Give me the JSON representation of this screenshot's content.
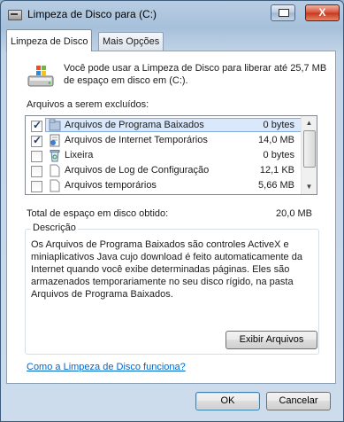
{
  "window": {
    "title": "Limpeza de Disco para  (C:)",
    "close_label": "X"
  },
  "tabs": [
    {
      "label": "Limpeza de Disco",
      "active": true
    },
    {
      "label": "Mais Opções",
      "active": false
    }
  ],
  "intro_text": "Você pode usar a Limpeza de Disco para liberar até 25,7 MB de espaço em disco em  (C:).",
  "files_label": "Arquivos a serem excluídos:",
  "files": [
    {
      "name": "Arquivos de Programa Baixados",
      "size": "0 bytes",
      "checked": true,
      "selected": true,
      "icon": "folder-icon"
    },
    {
      "name": "Arquivos de Internet Temporários",
      "size": "14,0 MB",
      "checked": true,
      "selected": false,
      "icon": "internet-files-icon"
    },
    {
      "name": "Lixeira",
      "size": "0 bytes",
      "checked": false,
      "selected": false,
      "icon": "recycle-bin-icon"
    },
    {
      "name": "Arquivos de Log de Configuração",
      "size": "12,1 KB",
      "checked": false,
      "selected": false,
      "icon": "document-icon"
    },
    {
      "name": "Arquivos temporários",
      "size": "5,66 MB",
      "checked": false,
      "selected": false,
      "icon": "document-icon"
    }
  ],
  "total_label": "Total de espaço em disco obtido:",
  "total_value": "20,0 MB",
  "description": {
    "title": "Descrição",
    "text": "Os Arquivos de Programa Baixados são controles ActiveX e miniaplicativos Java cujo download é feito automaticamente da Internet quando você exibe determinadas páginas. Eles são armazenados temporariamente no seu disco rígido, na pasta Arquivos de Programa Baixados.",
    "button_label": "Exibir Arquivos"
  },
  "help_link": "Como a Limpeza de Disco funciona?",
  "buttons": {
    "ok": "OK",
    "cancel": "Cancelar"
  }
}
